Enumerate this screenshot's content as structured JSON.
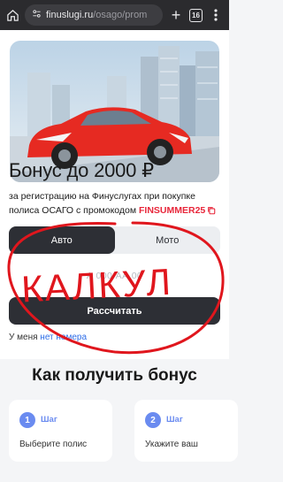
{
  "browser": {
    "url_host": "finuslugi.ru",
    "url_path": "/osago/prom",
    "tab_count": "16"
  },
  "promo": {
    "title": "Бонус до 2000 ₽",
    "subtitle_prefix": "за регистрацию на Финуслугах при покупке полиса ОСАГО с промокодом ",
    "promo_code": "FINSUMMER25"
  },
  "vehicle_tabs": [
    {
      "label": "Авто",
      "active": true
    },
    {
      "label": "Мото",
      "active": false
    }
  ],
  "plate_input": {
    "placeholder": "А 000 АА 00"
  },
  "calculate_button": "Рассчитать",
  "no_plate": {
    "prefix": "У меня ",
    "link": "нет номера"
  },
  "how_to": {
    "title": "Как получить бонус",
    "steps": [
      {
        "number": "1",
        "label": "Шаг",
        "text": "Выберите полис"
      },
      {
        "number": "2",
        "label": "Шаг",
        "text": "Укажите ваш"
      }
    ]
  },
  "annotation": {
    "text": "КАЛКУЛ",
    "color": "#e0161d"
  },
  "colors": {
    "accent_red": "#e8263a",
    "dark_button": "#2d2f35",
    "step_blue": "#6a8bf0",
    "link_blue": "#2f6ee8"
  }
}
